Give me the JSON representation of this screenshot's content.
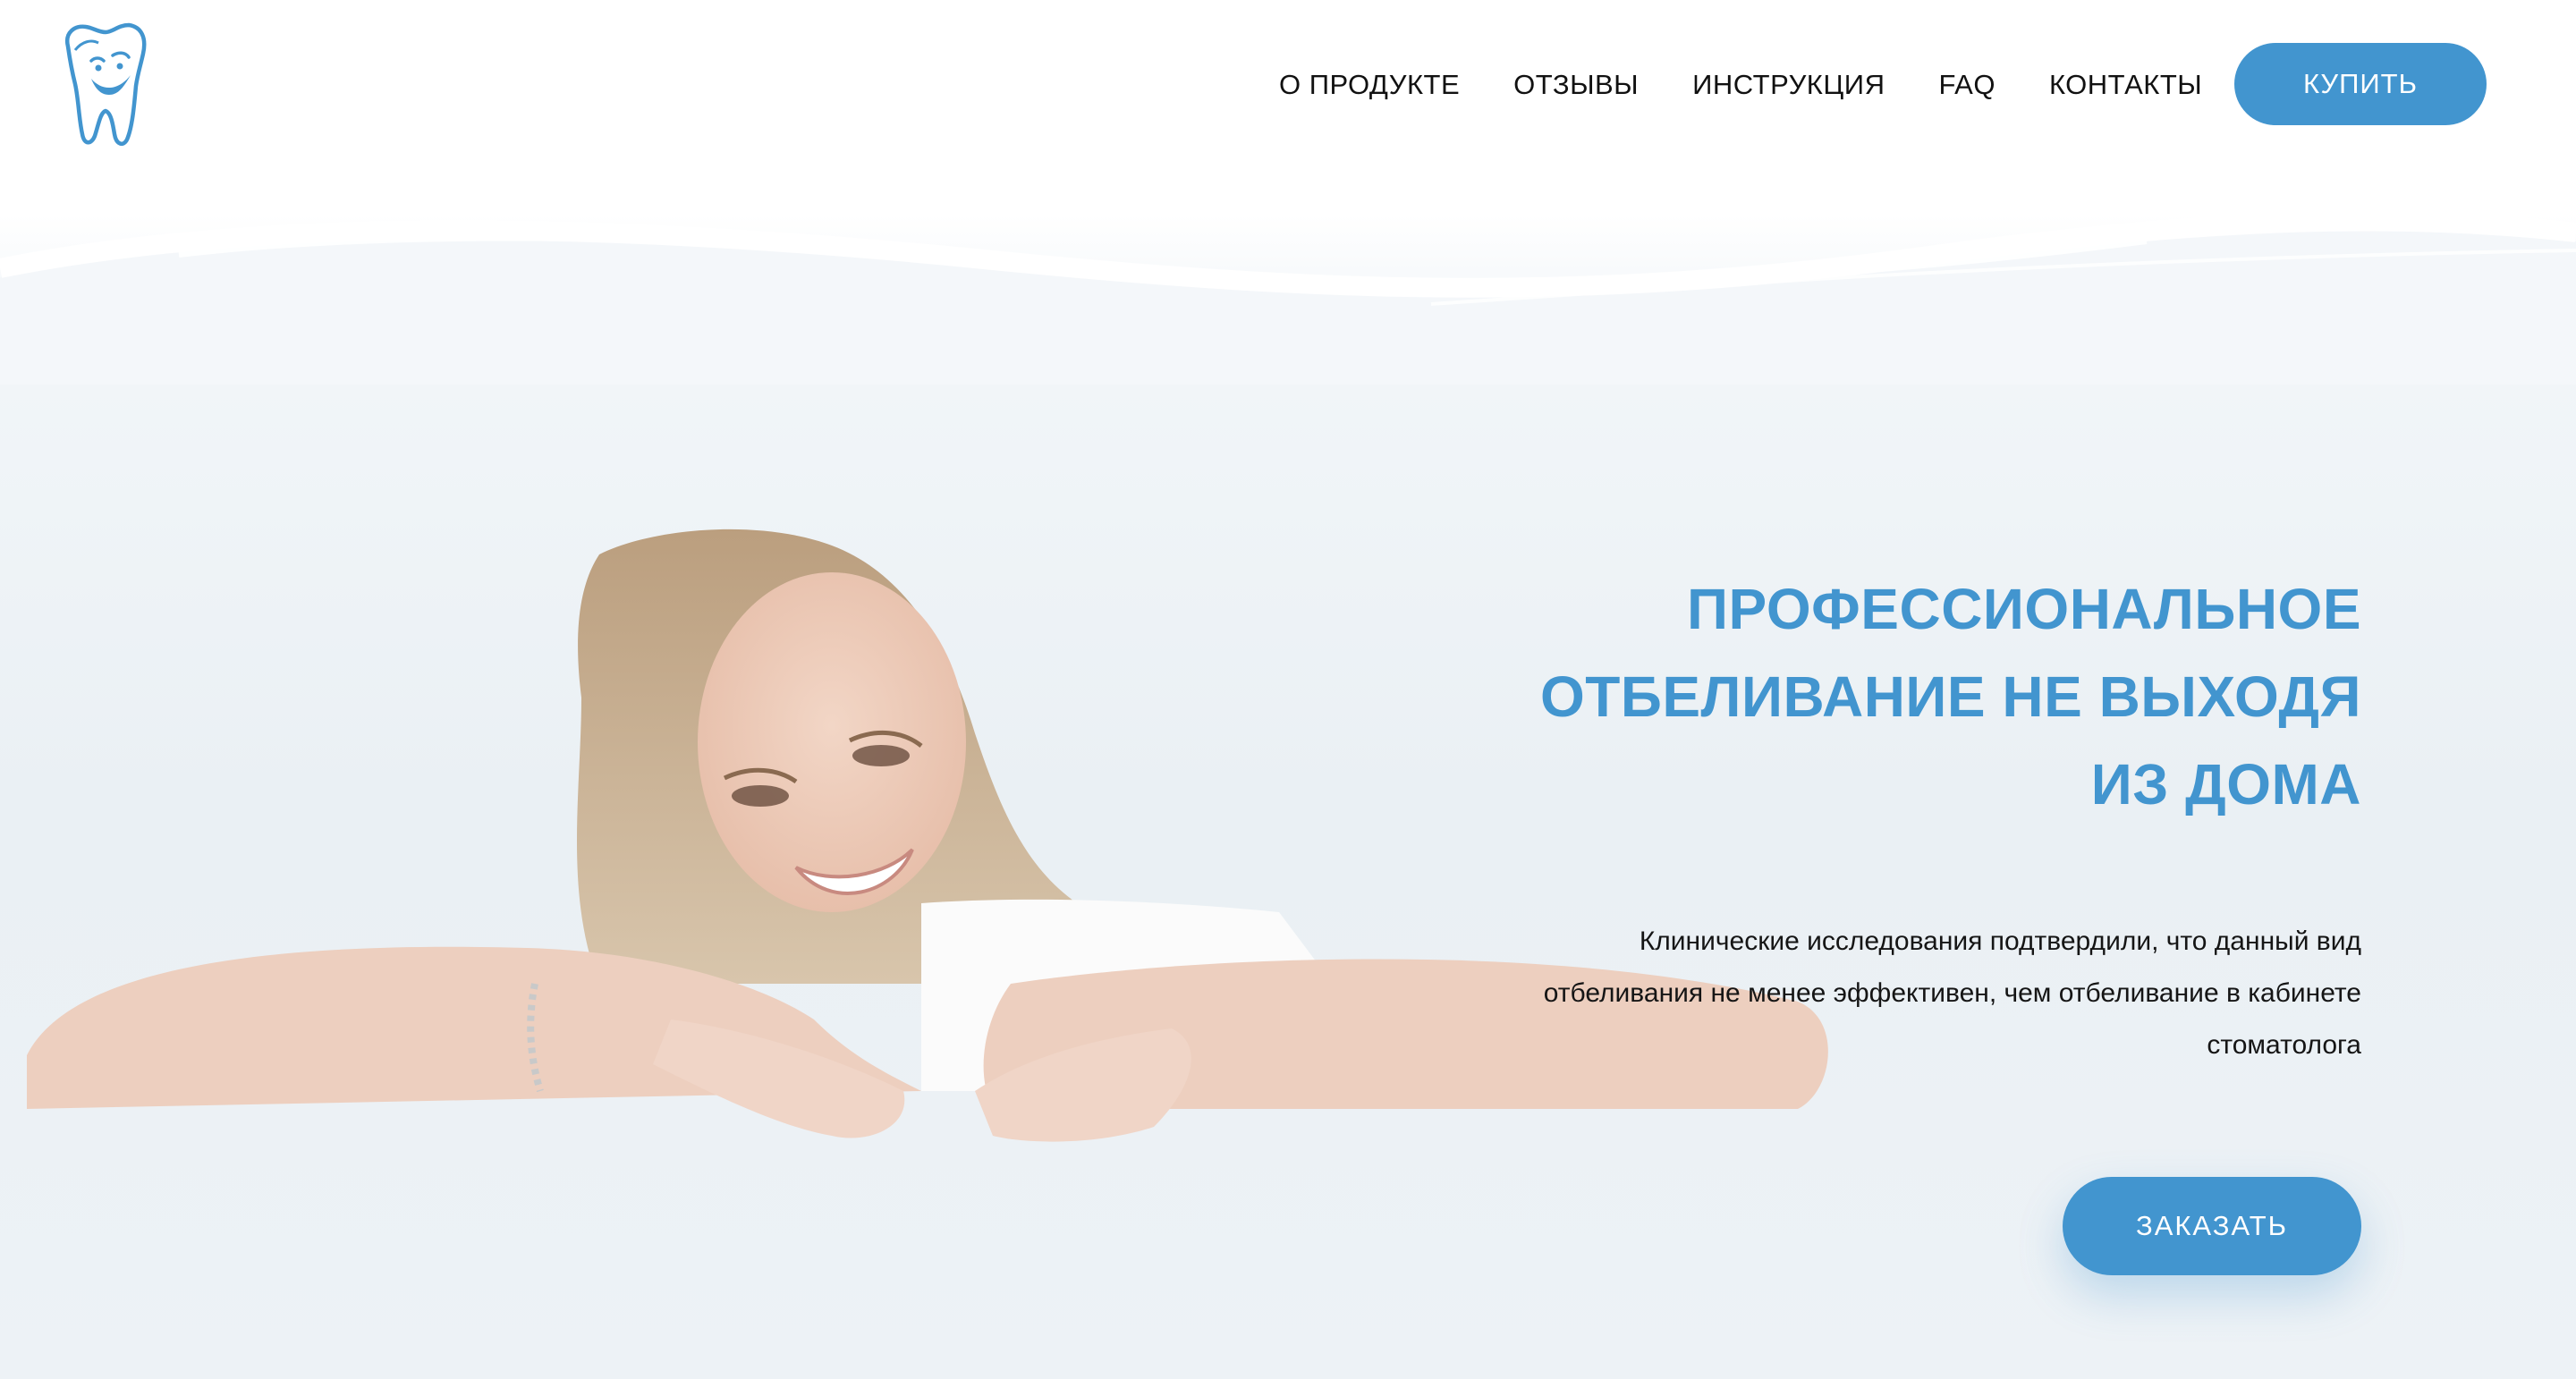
{
  "header": {
    "logo_icon": "tooth-mascot-icon",
    "nav": [
      {
        "label": "О ПРОДУКТЕ"
      },
      {
        "label": "ОТЗЫВЫ"
      },
      {
        "label": "ИНСТРУКЦИЯ"
      },
      {
        "label": "FAQ"
      },
      {
        "label": "КОНТАКТЫ"
      }
    ],
    "buy_label": "КУПИТЬ"
  },
  "hero": {
    "title_lines": [
      "ПРОФЕССИОНАЛЬНОЕ",
      "ОТБЕЛИВАНИЕ НЕ ВЫХОДЯ",
      "ИЗ ДОМА"
    ],
    "description_lines": [
      "Клинические исследования подтвердили, что данный вид",
      "отбеливания не менее эффективен, чем отбеливание в кабинете",
      "стоматолога"
    ],
    "order_label": "ЗАКАЗАТЬ",
    "photo": "smiling-woman-photo"
  },
  "colors": {
    "accent": "#4295cf",
    "text": "#111111",
    "background": "#eef3f6"
  }
}
